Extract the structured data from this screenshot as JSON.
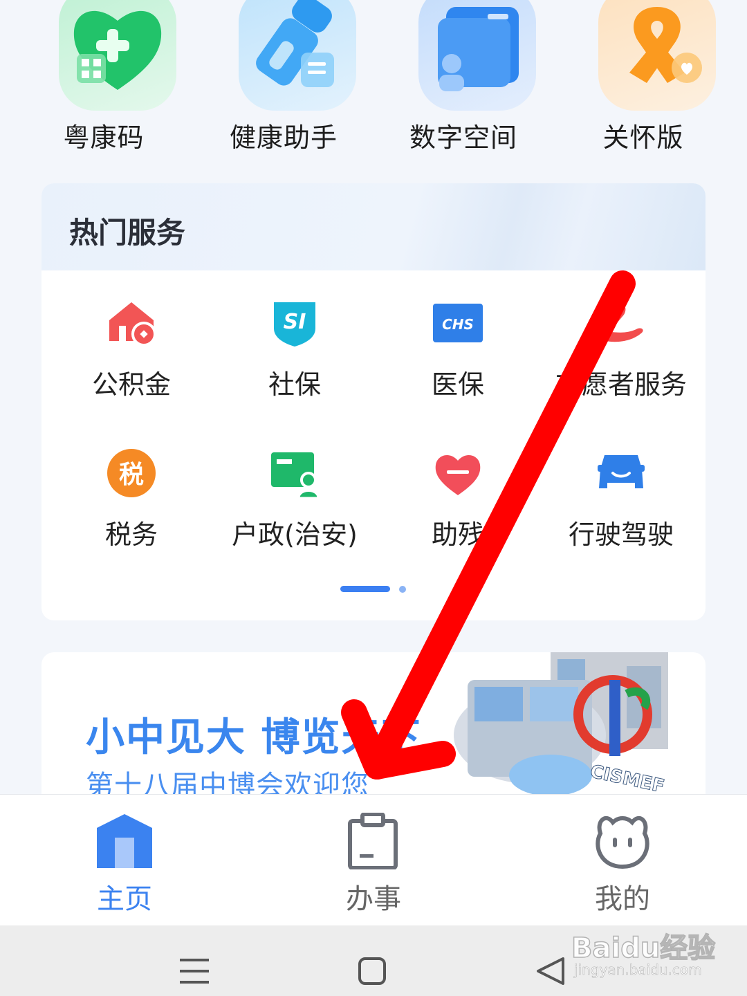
{
  "top_apps": [
    {
      "label": "粤康码",
      "icon": "green-heart-qr-icon"
    },
    {
      "label": "健康助手",
      "icon": "blue-flashlight-icon"
    },
    {
      "label": "数字空间",
      "icon": "blue-folder-icon"
    },
    {
      "label": "关怀版",
      "icon": "orange-ribbon-icon"
    }
  ],
  "hot_services": {
    "title": "热门服务",
    "items": [
      {
        "label": "公积金",
        "icon": "house-fund-icon"
      },
      {
        "label": "社保",
        "icon": "si-shield-icon"
      },
      {
        "label": "医保",
        "icon": "chs-card-icon"
      },
      {
        "label": "志愿者服务",
        "icon": "volunteer-hand-icon"
      },
      {
        "label": "税务",
        "icon": "tax-badge-icon"
      },
      {
        "label": "户政(治安)",
        "icon": "id-card-icon"
      },
      {
        "label": "助残",
        "icon": "heart-icon"
      },
      {
        "label": "行驶驾驶",
        "icon": "car-icon"
      }
    ]
  },
  "banner": {
    "title": "小中见大 博览天下",
    "subtitle": "第十八届中博会欢迎您",
    "logo_text": "CISMEF"
  },
  "tabbar": {
    "tabs": [
      {
        "label": "主页",
        "active": true
      },
      {
        "label": "办事",
        "active": false
      },
      {
        "label": "我的",
        "active": false
      }
    ]
  },
  "watermark": {
    "text": "Baidu经验",
    "sub": "jingyan.baidu.com"
  },
  "colors": {
    "accent": "#3b82f0",
    "arrow": "#ff0000"
  }
}
